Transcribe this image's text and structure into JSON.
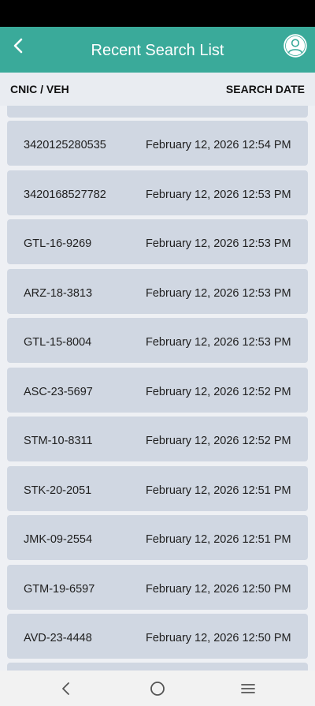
{
  "app_bar": {
    "title": "Recent Search List",
    "background": "#3aaa9a",
    "back_icon": "chevron-left-icon",
    "profile_icon": "user-circle-icon"
  },
  "columns": {
    "left": "CNIC / VEH",
    "right": "SEARCH DATE"
  },
  "items": [
    {
      "id": "3420125280535",
      "date": "February 12, 2026 12:54 PM"
    },
    {
      "id": "3420168527782",
      "date": "February 12, 2026 12:53 PM"
    },
    {
      "id": "GTL-16-9269",
      "date": "February 12, 2026 12:53 PM"
    },
    {
      "id": "ARZ-18-3813",
      "date": "February 12, 2026 12:53 PM"
    },
    {
      "id": "GTL-15-8004",
      "date": "February 12, 2026 12:53 PM"
    },
    {
      "id": "ASC-23-5697",
      "date": "February 12, 2026 12:52 PM"
    },
    {
      "id": "STM-10-8311",
      "date": "February 12, 2026 12:52 PM"
    },
    {
      "id": "STK-20-2051",
      "date": "February 12, 2026 12:51 PM"
    },
    {
      "id": "JMK-09-2554",
      "date": "February 12, 2026 12:51 PM"
    },
    {
      "id": "GTM-19-6597",
      "date": "February 12, 2026 12:50 PM"
    },
    {
      "id": "AVD-23-4448",
      "date": "February 12, 2026 12:50 PM"
    }
  ],
  "nav_bar": {
    "back_icon": "nav-back-icon",
    "home_icon": "nav-home-icon",
    "menu_icon": "nav-menu-icon"
  }
}
